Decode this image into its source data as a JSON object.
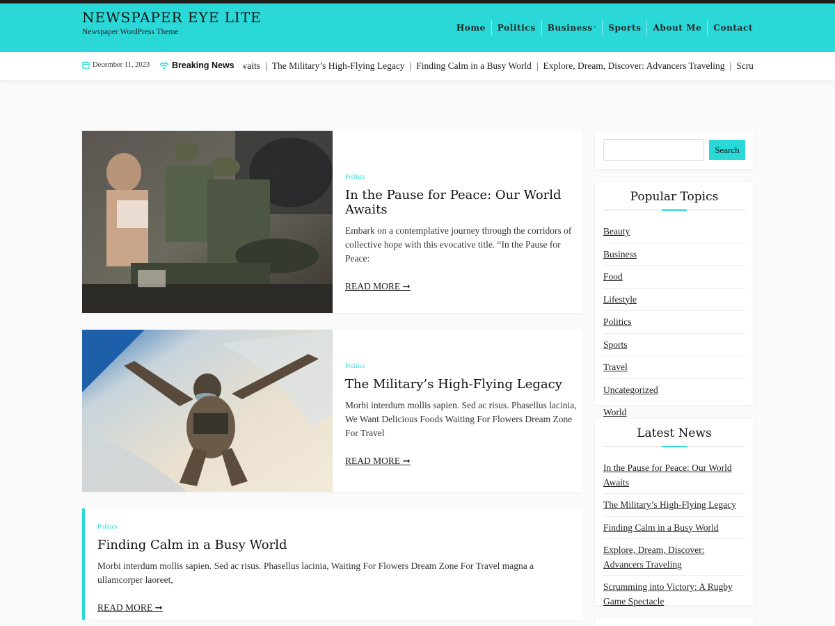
{
  "site": {
    "title": "NEWSPAPER EYE LITE",
    "tagline": "Newspaper WordPress Theme"
  },
  "nav": {
    "items": [
      "Home",
      "Politics",
      "Business",
      "Sports",
      "About Me",
      "Contact"
    ],
    "dropdown_indicator": "˅"
  },
  "ticker": {
    "date": "December 11, 2023",
    "label": "Breaking News",
    "items": [
      "Awaits",
      "The Military’s High-Flying Legacy",
      "Finding Calm in a Busy World",
      "Explore, Dream, Discover: Advancers Traveling",
      "Scrummin"
    ],
    "separator": "|"
  },
  "posts": [
    {
      "category": "Politics",
      "title": "In the Pause for Peace: Our World Awaits",
      "excerpt": "Embark on a contemplative journey through the corridors of collective hope with this evocative title. “In the Pause for Peace:",
      "read_more": "READ MORE"
    },
    {
      "category": "Politics",
      "title": "The Military’s High-Flying Legacy",
      "excerpt": "Morbi interdum mollis sapien. Sed ac risus. Phasellus lacinia, We Want Delicious Foods Waiting For Flowers Dream Zone For Travel",
      "read_more": "READ MORE"
    },
    {
      "category": "Politics",
      "title": "Finding Calm in a Busy World",
      "excerpt": "Morbi interdum mollis sapien. Sed ac risus. Phasellus lacinia, Waiting For Flowers Dream Zone For Travel magna a ullamcorper laoreet,",
      "read_more": "READ MORE"
    }
  ],
  "sidebar": {
    "search_button": "Search",
    "popular_topics": {
      "title": "Popular Topics",
      "items": [
        "Beauty",
        "Business",
        "Food",
        "Lifestyle",
        "Politics",
        "Sports",
        "Travel",
        "Uncategorized",
        "World"
      ]
    },
    "latest_news": {
      "title": "Latest News",
      "items": [
        "In the Pause for Peace: Our World Awaits",
        "The Military’s High-Flying Legacy",
        "Finding Calm in a Busy World",
        "Explore, Dream, Discover: Advancers Traveling",
        "Scrumming into Victory: A Rugby Game Spectacle"
      ]
    }
  },
  "colors": {
    "accent": "#2ad8d8",
    "topbar": "#1f1f1f",
    "background": "#fafafa"
  }
}
